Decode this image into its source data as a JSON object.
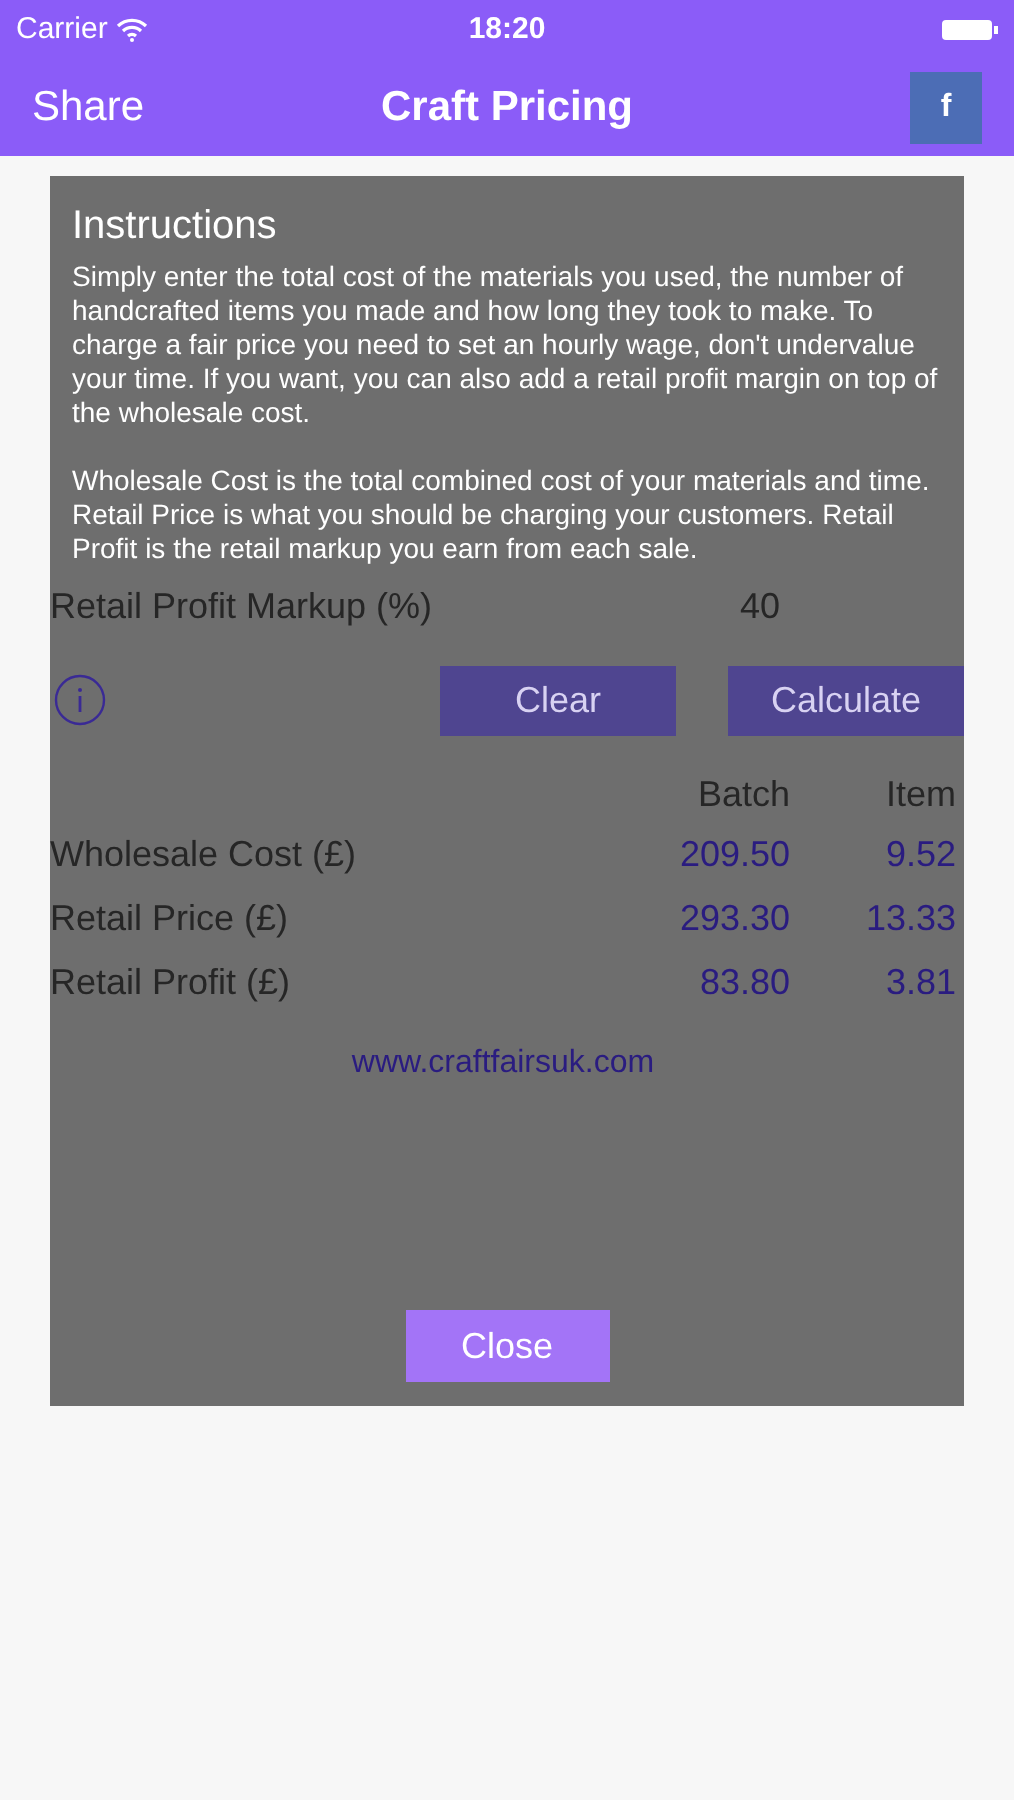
{
  "status_bar": {
    "carrier": "Carrier",
    "time": "18:20"
  },
  "nav": {
    "left": "Share",
    "title": "Craft Pricing",
    "right": "f"
  },
  "form": {
    "rows": [
      {
        "label": "Retail Profit Markup (%)",
        "value": "40"
      }
    ],
    "buttons": [
      "Clear",
      "Calculate"
    ],
    "columns": [
      "Batch",
      "Item"
    ],
    "results": [
      {
        "label": "Wholesale Cost (£)",
        "batch": "209.50",
        "item": "9.52"
      },
      {
        "label": "Retail Price (£)",
        "batch": "293.30",
        "item": "13.33"
      },
      {
        "label": "Retail Profit (£)",
        "batch": "83.80",
        "item": "3.81"
      }
    ],
    "link": "www.craftfairsuk.com"
  },
  "dialog": {
    "title": "Instructions",
    "paragraphs": [
      "Simply enter the total cost of the materials you used, the number of handcrafted items you made and how long they took to make. To charge a fair price you need to set an hourly wage, don't undervalue your time.  If you want, you can also add a retail profit margin on top of the wholesale cost.",
      "Wholesale Cost is the total combined cost of your materials and time. Retail Price is what you should be charging your customers. Retail Profit is the retail markup you earn from each sale."
    ],
    "button": "Close"
  }
}
